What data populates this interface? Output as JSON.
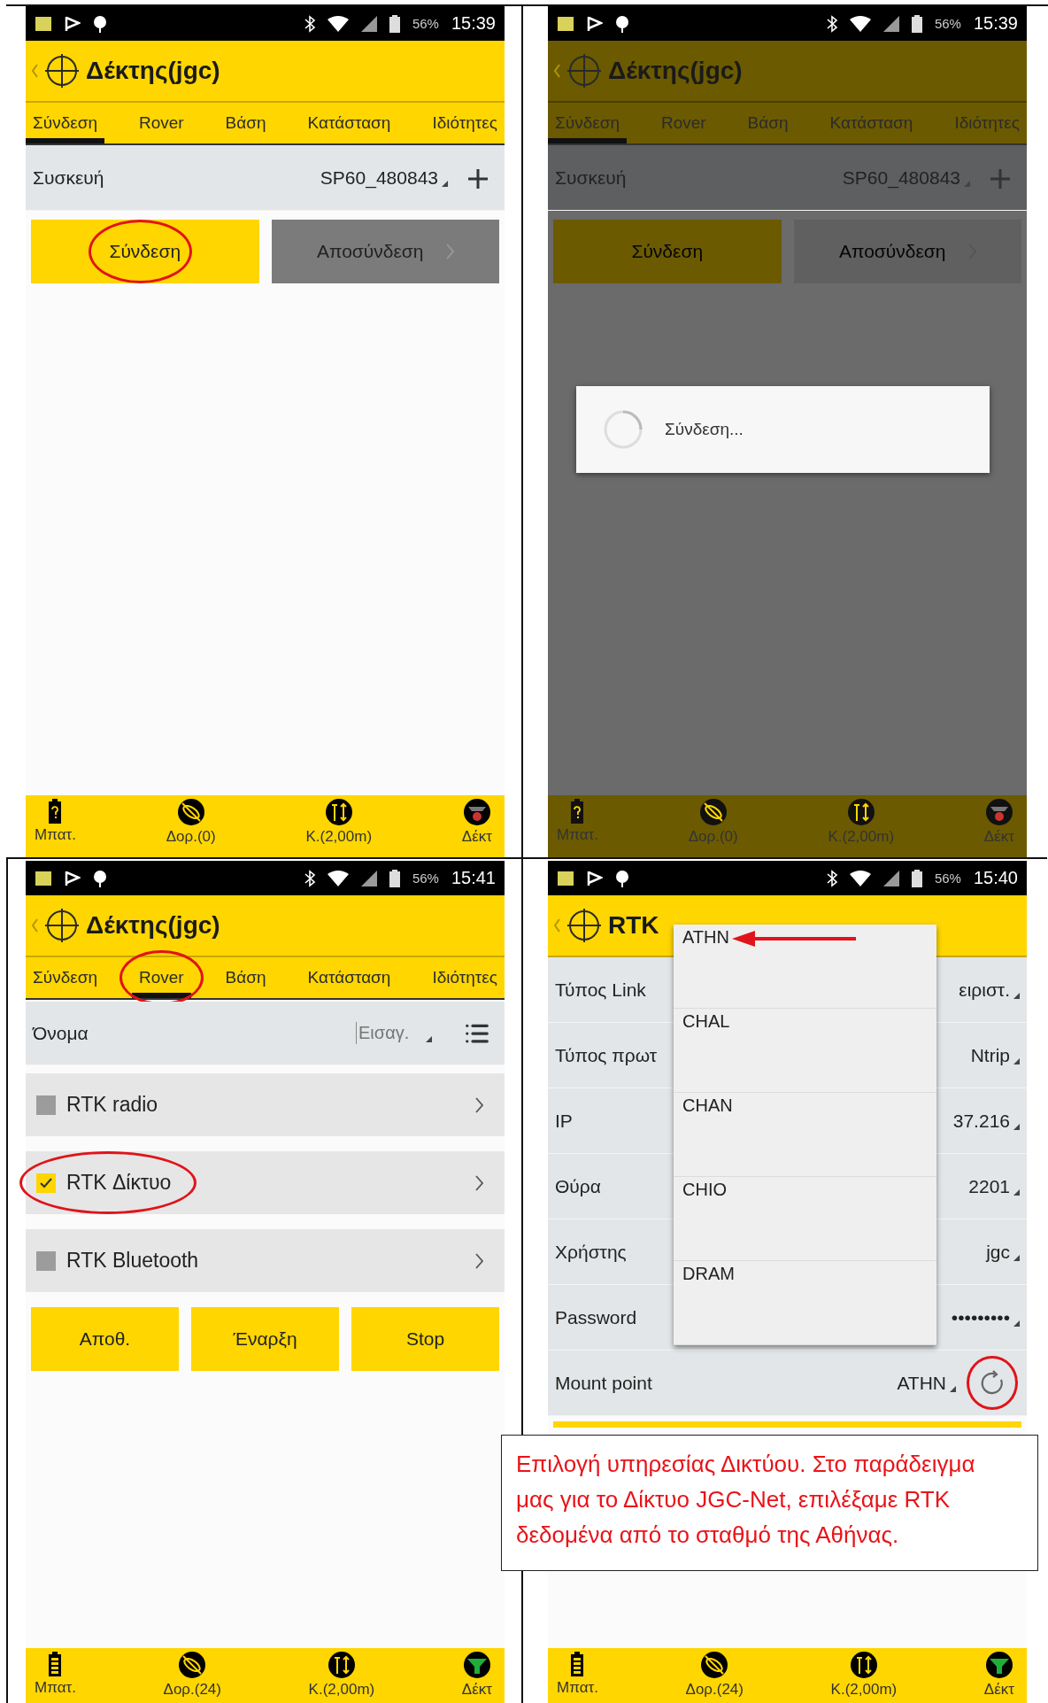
{
  "screens": [
    {
      "kind": "connection",
      "dimmed": false,
      "receiver_connected": false,
      "status_bar": {
        "battery": "56%",
        "time": "15:39"
      },
      "title": "Δέκτης(jgc)",
      "tabs": [
        {
          "label": "Σύνδεση",
          "selected": true,
          "highlighted": false
        },
        {
          "label": "Rover",
          "selected": false,
          "highlighted": false
        },
        {
          "label": "Βάση",
          "selected": false,
          "highlighted": false
        },
        {
          "label": "Κατάσταση",
          "selected": false,
          "highlighted": false
        },
        {
          "label": "Ιδιότητες",
          "selected": false,
          "highlighted": false
        }
      ],
      "device": {
        "label": "Συσκευή",
        "value": "SP60_480843"
      },
      "buttons": [
        {
          "label": "Σύνδεση",
          "kind": "primary",
          "highlighted": true
        },
        {
          "label": "Αποσύνδεση",
          "kind": "secondary",
          "highlighted": false
        }
      ],
      "bottom_nav": [
        {
          "kind": "battery",
          "label": "Μπατ."
        },
        {
          "kind": "satellites",
          "label": "Δορ.(0)"
        },
        {
          "kind": "pole",
          "label": "Κ.(2,00m)"
        },
        {
          "kind": "receiver",
          "label": "Δέκτ"
        }
      ]
    },
    {
      "kind": "connection",
      "dimmed": true,
      "receiver_connected": false,
      "status_bar": {
        "battery": "56%",
        "time": "15:39"
      },
      "title": "Δέκτης(jgc)",
      "tabs": [
        {
          "label": "Σύνδεση",
          "selected": true,
          "highlighted": false
        },
        {
          "label": "Rover",
          "selected": false,
          "highlighted": false
        },
        {
          "label": "Βάση",
          "selected": false,
          "highlighted": false
        },
        {
          "label": "Κατάσταση",
          "selected": false,
          "highlighted": false
        },
        {
          "label": "Ιδιότητες",
          "selected": false,
          "highlighted": false
        }
      ],
      "device": {
        "label": "Συσκευή",
        "value": "SP60_480843"
      },
      "buttons": [
        {
          "label": "Σύνδεση",
          "kind": "primary",
          "highlighted": false
        },
        {
          "label": "Αποσύνδεση",
          "kind": "secondary",
          "highlighted": false
        }
      ],
      "dialog": {
        "message": "Σύνδεση..."
      },
      "bottom_nav": [
        {
          "kind": "battery",
          "label": "Μπατ."
        },
        {
          "kind": "satellites",
          "label": "Δορ.(0)"
        },
        {
          "kind": "pole",
          "label": "Κ.(2,00m)"
        },
        {
          "kind": "receiver",
          "label": "Δέκτ"
        }
      ]
    },
    {
      "kind": "rover",
      "dimmed": false,
      "receiver_connected": true,
      "status_bar": {
        "battery": "56%",
        "time": "15:41"
      },
      "title": "Δέκτης(jgc)",
      "tabs": [
        {
          "label": "Σύνδεση",
          "selected": false,
          "highlighted": false
        },
        {
          "label": "Rover",
          "selected": true,
          "highlighted": true
        },
        {
          "label": "Βάση",
          "selected": false,
          "highlighted": false
        },
        {
          "label": "Κατάσταση",
          "selected": false,
          "highlighted": false
        },
        {
          "label": "Ιδιότητες",
          "selected": false,
          "highlighted": false
        }
      ],
      "name_field": {
        "label": "Όνομα",
        "placeholder": "Εισαγ."
      },
      "options": [
        {
          "label": "RTK radio",
          "checked": false,
          "highlighted": false
        },
        {
          "label": "RTK Δίκτυο",
          "checked": true,
          "highlighted": true
        },
        {
          "label": "RTK Bluetooth",
          "checked": false,
          "highlighted": false
        }
      ],
      "buttons": [
        {
          "label": "Αποθ.",
          "kind": "primary",
          "highlighted": false
        },
        {
          "label": "Έναρξη",
          "kind": "primary",
          "highlighted": false
        },
        {
          "label": "Stop",
          "kind": "primary",
          "highlighted": false
        }
      ],
      "bottom_nav": [
        {
          "kind": "battery",
          "label": "Μπατ."
        },
        {
          "kind": "satellites",
          "label": "Δορ.(24)"
        },
        {
          "kind": "pole",
          "label": "Κ.(2,00m)"
        },
        {
          "kind": "receiver",
          "label": "Δέκτ"
        }
      ]
    },
    {
      "kind": "rtk_network",
      "dimmed": false,
      "receiver_connected": true,
      "status_bar": {
        "battery": "56%",
        "time": "15:40"
      },
      "title": "RTK",
      "fields": [
        {
          "label": "Τύπος Link",
          "value": "ειριστ."
        },
        {
          "label": "Τύπος πρωτ",
          "value": "Ntrip"
        },
        {
          "label": "IP",
          "value": "37.216"
        },
        {
          "label": "Θύρα",
          "value": "2201"
        },
        {
          "label": "Χρήστης",
          "value": "jgc"
        },
        {
          "label": "Password",
          "value": "•••••••••"
        }
      ],
      "mount_point": {
        "label": "Mount point",
        "value": "ATHN",
        "highlighted": true
      },
      "dropdown": {
        "items": [
          {
            "label": "ATHN",
            "marked": true
          },
          {
            "label": "CHAL",
            "marked": false
          },
          {
            "label": "CHAN",
            "marked": false
          },
          {
            "label": "CHIO",
            "marked": false
          },
          {
            "label": "DRAM",
            "marked": false
          }
        ]
      },
      "bottom_nav": [
        {
          "kind": "battery",
          "label": "Μπατ."
        },
        {
          "kind": "satellites",
          "label": "Δορ.(24)"
        },
        {
          "kind": "pole",
          "label": "Κ.(2,00m)"
        },
        {
          "kind": "receiver",
          "label": "Δέκτ"
        }
      ]
    }
  ],
  "caption": "Επιλογή υπηρεσίας Δικτύου. Στο παράδειγμα μας για το Δίκτυο JGC-Net, επιλέξαμε RTK δεδομένα από το σταθμό της Αθήνας."
}
